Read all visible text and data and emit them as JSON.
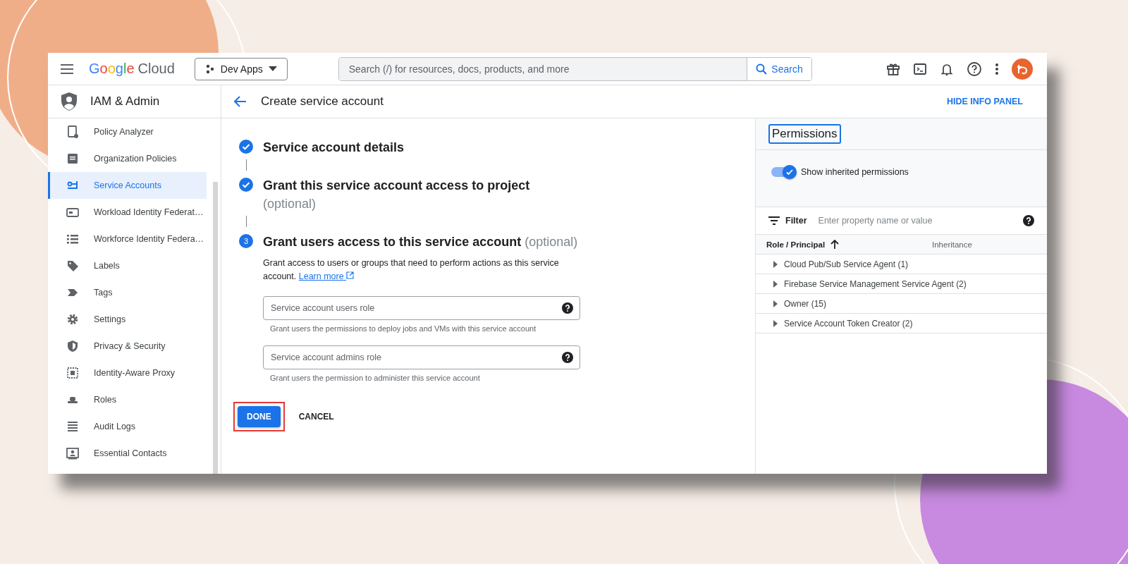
{
  "topbar": {
    "logo": {
      "brand": "Google",
      "product": "Cloud"
    },
    "project": "Dev Apps",
    "search": {
      "placeholder": "Search (/) for resources, docs, products, and more",
      "button": "Search"
    }
  },
  "sidebar": {
    "title": "IAM & Admin",
    "items": [
      {
        "label": "Policy Analyzer",
        "selected": false
      },
      {
        "label": "Organization Policies",
        "selected": false
      },
      {
        "label": "Service Accounts",
        "selected": true
      },
      {
        "label": "Workload Identity Federat…",
        "selected": false
      },
      {
        "label": "Workforce Identity Federa…",
        "selected": false
      },
      {
        "label": "Labels",
        "selected": false
      },
      {
        "label": "Tags",
        "selected": false
      },
      {
        "label": "Settings",
        "selected": false
      },
      {
        "label": "Privacy & Security",
        "selected": false
      },
      {
        "label": "Identity-Aware Proxy",
        "selected": false
      },
      {
        "label": "Roles",
        "selected": false
      },
      {
        "label": "Audit Logs",
        "selected": false
      },
      {
        "label": "Essential Contacts",
        "selected": false
      }
    ]
  },
  "header": {
    "title": "Create service account",
    "action": "HIDE INFO PANEL"
  },
  "steps": [
    {
      "completed": true,
      "title": "Service account details"
    },
    {
      "completed": true,
      "title": "Grant this service account access to project",
      "optional": "(optional)"
    },
    {
      "completed": false,
      "number": "3",
      "title": "Grant users access to this service account",
      "optional": "(optional)",
      "description": "Grant access to users or groups that need to perform actions as this service account.",
      "link": "Learn more",
      "fields": [
        {
          "placeholder": "Service account users role",
          "hint": "Grant users the permissions to deploy jobs and VMs with this service account"
        },
        {
          "placeholder": "Service account admins role",
          "hint": "Grant users the permission to administer this service account"
        }
      ]
    }
  ],
  "actions": {
    "done": {
      "label": "DONE",
      "highlighted": true
    },
    "cancel": "CANCEL"
  },
  "info_panel": {
    "title": "Permissions",
    "title_highlighted": true,
    "toggle": {
      "label": "Show inherited permissions",
      "on": true
    },
    "filter": {
      "label": "Filter",
      "placeholder": "Enter property name or value"
    },
    "table": {
      "columns": [
        "Role / Principal",
        "Inheritance"
      ],
      "rows": [
        {
          "label": "Cloud Pub/Sub Service Agent (1)",
          "expanded": false
        },
        {
          "label": "Firebase Service Management Service Agent (2)",
          "expanded": false
        },
        {
          "label": "Owner (15)",
          "expanded": false
        },
        {
          "label": "Service Account Token Creator (2)",
          "expanded": false
        }
      ]
    }
  }
}
